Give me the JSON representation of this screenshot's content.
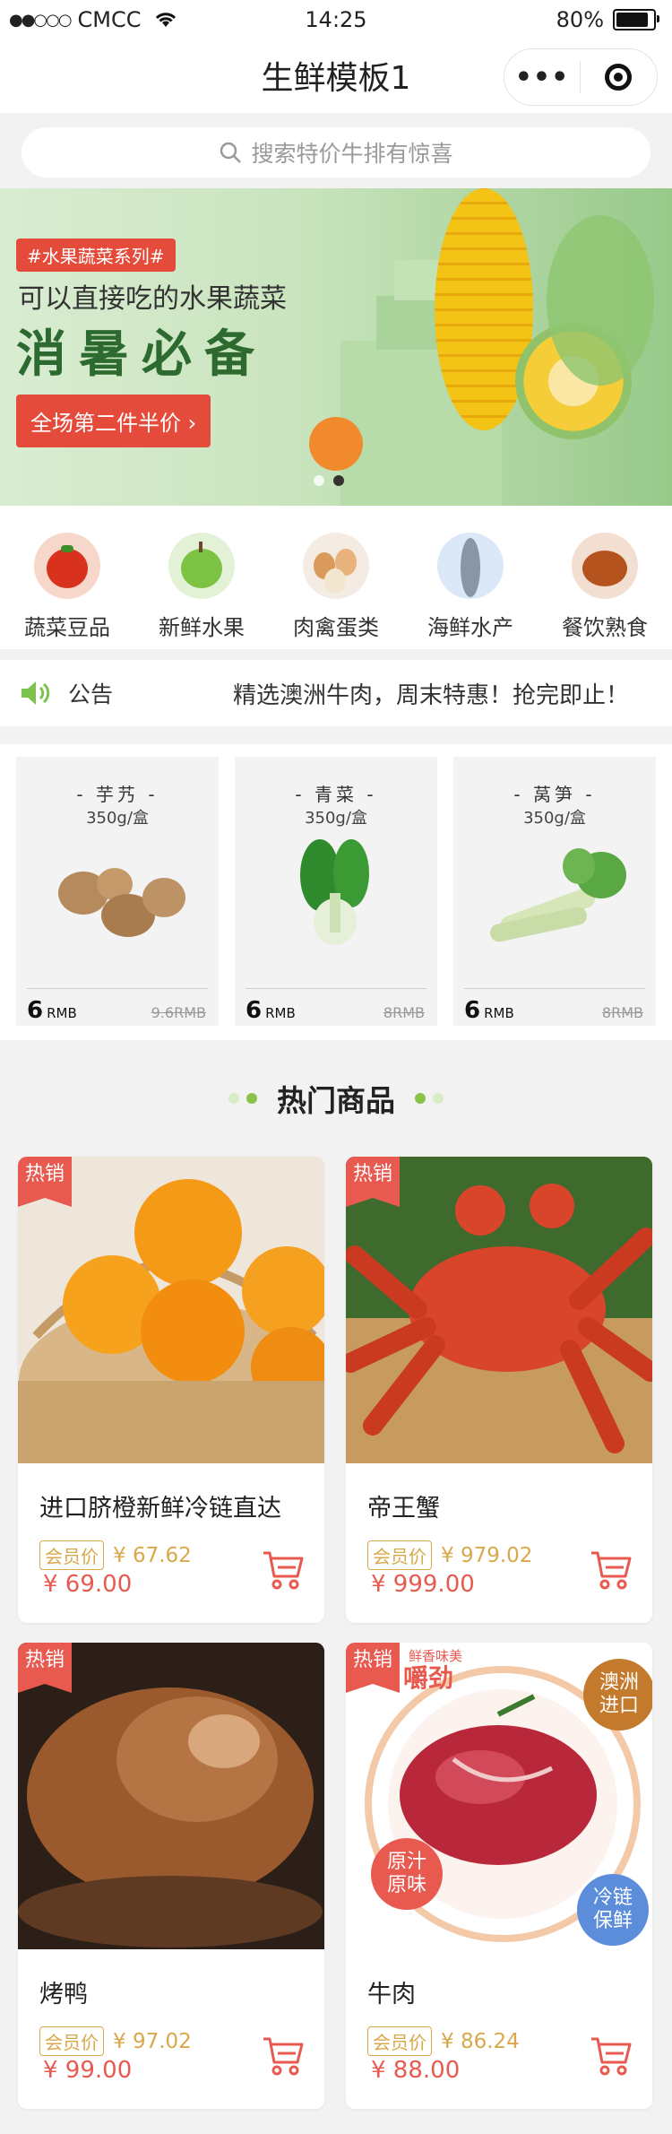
{
  "status_bar": {
    "signal": "●●○○○",
    "carrier": "CMCC",
    "time": "14:25",
    "battery": "80%"
  },
  "nav": {
    "title": "生鲜模板1"
  },
  "search": {
    "placeholder": "搜索特价牛排有惊喜"
  },
  "banner": {
    "tag": "#水果蔬菜系列#",
    "line1": "可以直接吃的水果蔬菜",
    "line2": "消暑必备",
    "promo": "全场第二件半价 ›",
    "slide_count": 2,
    "active_slide": 2
  },
  "categories": [
    {
      "label": "蔬菜豆品",
      "icon": "tomato-icon"
    },
    {
      "label": "新鲜水果",
      "icon": "apple-icon"
    },
    {
      "label": "肉禽蛋类",
      "icon": "eggs-icon"
    },
    {
      "label": "海鲜水产",
      "icon": "fish-icon"
    },
    {
      "label": "餐饮熟食",
      "icon": "roast-chicken-icon"
    }
  ],
  "notice": {
    "label": "公告",
    "text": "精选澳洲牛肉，周末特惠！抢完即止！"
  },
  "specials": [
    {
      "name": "- 芋艿 -",
      "weight": "350g/盒",
      "price": "6",
      "unit": "RMB",
      "old_price": "9.6RMB"
    },
    {
      "name": "- 青菜 -",
      "weight": "350g/盒",
      "price": "6",
      "unit": "RMB",
      "old_price": "8RMB"
    },
    {
      "name": "- 莴笋 -",
      "weight": "350g/盒",
      "price": "6",
      "unit": "RMB",
      "old_price": "8RMB"
    }
  ],
  "section": {
    "title": "热门商品"
  },
  "products": [
    {
      "hot": "热销",
      "name": "进口脐橙新鲜冷链直达",
      "member_tag": "会员价",
      "member_price": "¥ 67.62",
      "price": "¥ 69.00"
    },
    {
      "hot": "热销",
      "name": "帝王蟹",
      "member_tag": "会员价",
      "member_price": "¥ 979.02",
      "price": "¥ 999.00"
    },
    {
      "hot": "热销",
      "name": "烤鸭",
      "member_tag": "会员价",
      "member_price": "¥ 97.02",
      "price": "¥ 99.00"
    },
    {
      "hot": "热销",
      "name": "牛肉",
      "member_tag": "会员价",
      "member_price": "¥ 86.24",
      "price": "¥ 88.00",
      "image_texts": {
        "top_small": "鲜香味美",
        "top": "嚼劲",
        "badge1": "澳洲进口",
        "badge2": "原汁原味",
        "badge3": "冷链保鲜"
      }
    }
  ],
  "colors": {
    "accent_red": "#e85a50",
    "member_gold": "#d9a84a",
    "banner_green": "#2d6a30",
    "section_dot": "#8bc34a"
  }
}
